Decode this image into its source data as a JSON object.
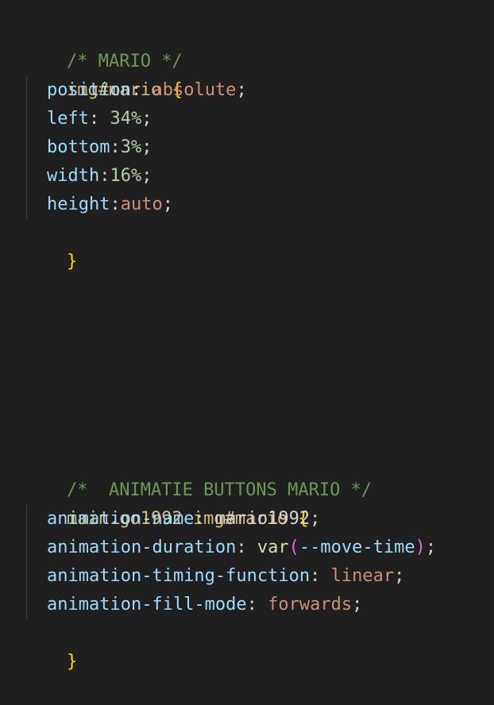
{
  "block1": {
    "comment": "/* MARIO */",
    "selector": "img#mario",
    "open_brace": "{",
    "close_brace": "}",
    "declarations": [
      {
        "prop": "position",
        "sep": ": ",
        "value": "absolute",
        "semi": ";"
      },
      {
        "prop": "left",
        "sep": ": ",
        "value": "34%",
        "semi": ";"
      },
      {
        "prop": "bottom",
        "sep": ":",
        "value": "3%",
        "semi": ";"
      },
      {
        "prop": "width",
        "sep": ":",
        "value": "16%",
        "semi": ";"
      },
      {
        "prop": "height",
        "sep": ":",
        "value": "auto",
        "semi": ";"
      }
    ]
  },
  "block2": {
    "comment": "/*  ANIMATIE BUTTONS MARIO */",
    "selector": "main.go1992 img#mario",
    "open_brace": "{",
    "close_brace": "}",
    "declarations": [
      {
        "prop": "animation-name",
        "sep": ": ",
        "value": "mario1992",
        "semi": ";"
      },
      {
        "prop": "animation-duration",
        "sep": ": ",
        "func": "var",
        "paren_open": "(",
        "arg": "--move-time",
        "paren_close": ")",
        "semi": ";"
      },
      {
        "prop": "animation-timing-function",
        "sep": ": ",
        "value": "linear",
        "semi": ";"
      },
      {
        "prop": "animation-fill-mode",
        "sep": ": ",
        "value": "forwards",
        "semi": ";"
      }
    ]
  },
  "colors": {
    "background": "#1f1f1f",
    "comment": "#6a9955",
    "selector": "#d7ba7d",
    "brace": "#ffd700",
    "property": "#9cdcfe",
    "string_value": "#ce9178",
    "number_value": "#b5cea8",
    "function": "#dcdcaa",
    "paren": "#da70d6"
  }
}
